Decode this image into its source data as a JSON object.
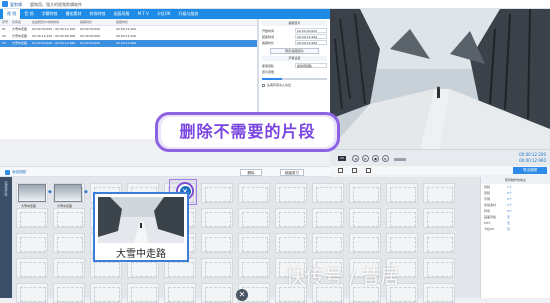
{
  "titlebar": {
    "app_name": "爱剪辑",
    "document": "超和用、强大的视频剪辑软件"
  },
  "tabs": [
    "视 频",
    "音 频",
    "字幕特效",
    "叠加素材",
    "转场特效",
    "画面风格",
    "M T V",
    "卡拉OK",
    "升级与服务"
  ],
  "active_tab_index": 0,
  "file_table": {
    "headers": [
      "序号",
      "文件名",
      "在最终影片中的时间",
      "截取时长",
      "截取时长"
    ],
    "rows": [
      [
        "01",
        "大雪中走路",
        "00:00:00.000 - 00:00:12.200",
        "00:00:00.000",
        "00:00:12.200"
      ],
      [
        "02",
        "大雪中走路",
        "00:00:12.200 - 00:00:00.000",
        "00:00:00.000",
        "00:00:12.200"
      ],
      [
        "03",
        "大雪中走路",
        "00:00:00.000 - 00:00:12.960",
        "00:00:00.000",
        "00:00:12.960"
      ]
    ],
    "selected_row": 2
  },
  "properties": {
    "section1": "截取原片",
    "rows": [
      {
        "label": "开始时间",
        "value": "00:00:00.000"
      },
      {
        "label": "结束时间",
        "value": "00:00:12.960"
      },
      {
        "label": "截取时长",
        "value": "00:00:12.960"
      }
    ],
    "btn_preview": "预览/截取原片",
    "section2": "声音设置",
    "audio_label": "使用音轨",
    "audio_value": "提供音频轨",
    "volume_label": "原片音量",
    "volume_value": 0.3,
    "checkbox_label": "头尾声音淡入淡出"
  },
  "preview": {
    "time_current": "00:00:12.200",
    "time_total": "00:00:12.960",
    "speed": "2X"
  },
  "bottom_bar": {
    "add_label": "添加视频",
    "delete_label": "删除",
    "clip_label": "超级剪刀"
  },
  "export_label": "导出视频",
  "timeline": {
    "side_label": "已添加片段",
    "small_clips": [
      {
        "label": "大雪中走路"
      },
      {
        "label": "大雪中走路"
      }
    ],
    "big_clip_label": "大雪中走路"
  },
  "right_panel": {
    "title": "所有制作的信息",
    "rows": [
      {
        "k": "视频",
        "v": "1个"
      },
      {
        "k": "音频",
        "v": "0个"
      },
      {
        "k": "字幕",
        "v": "0个"
      },
      {
        "k": "叠加素材",
        "v": "0个"
      },
      {
        "k": "转场",
        "v": "0个"
      },
      {
        "k": "画面风格",
        "v": "无"
      },
      {
        "k": "MTV",
        "v": "无"
      },
      {
        "k": "卡拉OK",
        "v": "无"
      }
    ]
  },
  "banner_text": "删除不需要的片段",
  "watermark": "快传号 / 昔居",
  "colors": {
    "accent": "#1e8ce6",
    "banner_purple": "#8d63e4"
  }
}
